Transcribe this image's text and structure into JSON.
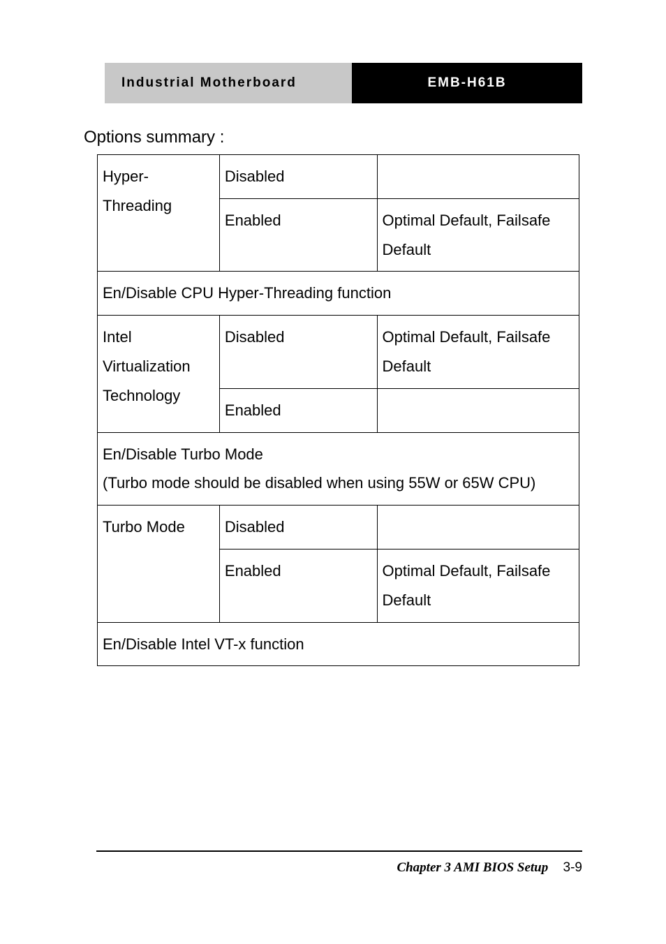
{
  "header": {
    "left": "Industrial Motherboard",
    "right": "EMB-H61B"
  },
  "options_title": "Options summary :",
  "rows": {
    "hyper_threading": {
      "name": "Hyper-Threading",
      "opt_disabled": "Disabled",
      "opt_enabled": "Enabled",
      "enabled_note": "Optimal Default, Failsafe Default"
    },
    "desc_ht": "En/Disable CPU Hyper-Threading function",
    "intel_vt": {
      "name": "Intel Virtualization Technology",
      "opt_disabled": "Disabled",
      "opt_enabled": "Enabled",
      "disabled_note": "Optimal Default, Failsafe Default"
    },
    "desc_turbo": "En/Disable Turbo Mode\n(Turbo mode should be disabled when using 55W or 65W CPU)",
    "turbo_mode": {
      "name": "Turbo Mode",
      "opt_disabled": "Disabled",
      "opt_enabled": "Enabled",
      "enabled_note": "Optimal Default, Failsafe Default"
    },
    "desc_vtx": "En/Disable Intel VT-x function"
  },
  "footer": {
    "chapter": "Chapter 3 AMI BIOS Setup",
    "page": "3-9"
  }
}
